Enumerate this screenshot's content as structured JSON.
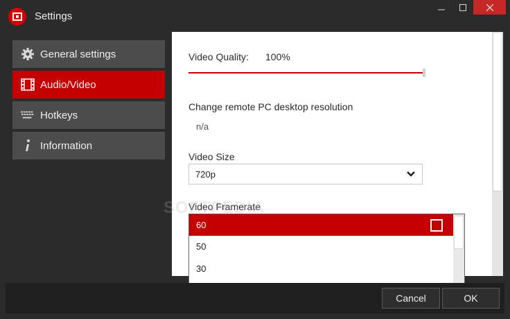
{
  "window": {
    "title": "Settings",
    "accent": "#c40000"
  },
  "sidebar": {
    "items": [
      {
        "label": "General settings",
        "icon": "gear-icon",
        "active": false
      },
      {
        "label": "Audio/Video",
        "icon": "film-icon",
        "active": true
      },
      {
        "label": "Hotkeys",
        "icon": "keyboard-icon",
        "active": false
      },
      {
        "label": "Information",
        "icon": "info-icon",
        "active": false
      }
    ]
  },
  "main": {
    "video_quality": {
      "label": "Video Quality:",
      "value": "100%",
      "percent": 100
    },
    "resolution": {
      "label": "Change remote PC desktop resolution",
      "value": "n/a"
    },
    "video_size": {
      "label": "Video Size",
      "selected": "720p"
    },
    "video_framerate": {
      "label": "Video Framerate",
      "options": [
        "60",
        "50",
        "30"
      ],
      "selected": "60"
    }
  },
  "footer": {
    "cancel_label": "Cancel",
    "ok_label": "OK"
  },
  "watermark": "SOFTPEDIA"
}
